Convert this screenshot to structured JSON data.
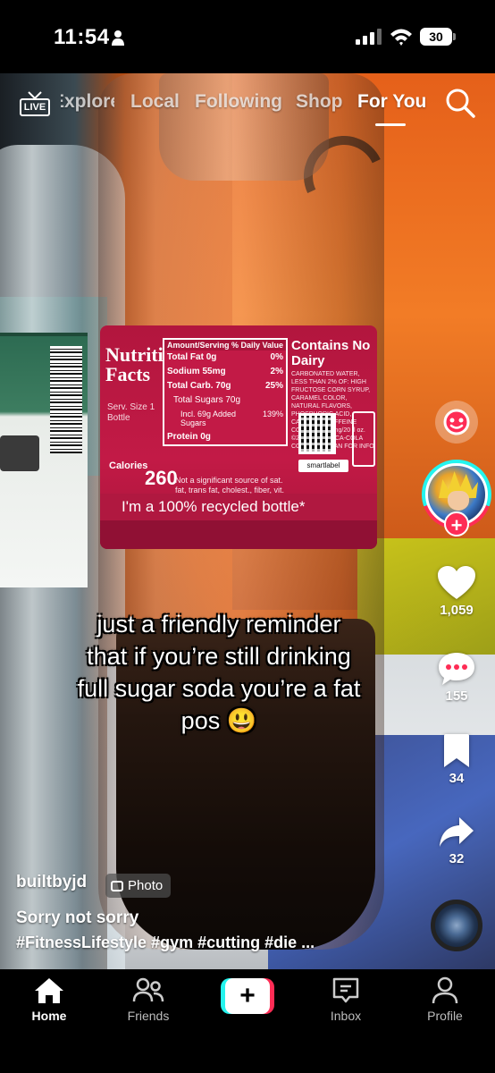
{
  "status_bar": {
    "time": "11:54",
    "battery": "30"
  },
  "top_nav": {
    "live_label": "LIVE",
    "tabs": [
      {
        "label": "Explore",
        "active": false
      },
      {
        "label": "Local",
        "active": false
      },
      {
        "label": "Following",
        "active": false
      },
      {
        "label": "Shop",
        "active": false
      },
      {
        "label": "For You",
        "active": true
      }
    ]
  },
  "media": {
    "label": {
      "nutrition_title": "Nutrition Facts",
      "serv_size": "Serv. Size 1 Bottle",
      "table_header_left": "Amount/Serving",
      "table_header_right": "% Daily Value",
      "rows": [
        {
          "name": "Total Fat 0g",
          "dv": "0%"
        },
        {
          "name": "Sodium 55mg",
          "dv": "2%"
        },
        {
          "name": "Total Carb. 70g",
          "dv": "25%"
        },
        {
          "name": "Total Sugars 70g",
          "dv": ""
        },
        {
          "name": "Incl. 69g Added Sugars",
          "dv": "139%"
        },
        {
          "name": "Protein 0g",
          "dv": ""
        }
      ],
      "calories_label": "Calories",
      "calories_value": "260",
      "note": "Not a significant source of sat. fat, trans fat, cholest., fiber, vit. D, calcium, iron and potas.",
      "contains_title": "Contains No Dairy",
      "contains_text": "CARBONATED WATER, LESS THAN 2% OF: HIGH FRUCTOSE CORN SYRUP, CARAMEL COLOR, NATURAL FLAVORS, PHOSPHORIC ACID, CAFFEINE. CAFFEINE CONTENT: 57 mg/20 fl oz. ©2026 THE COCA-COLA COMPANY. SCAN FOR INFO",
      "smartlabel": "smartlabel",
      "recycled_line": "I'm a 100% recycled bottle*"
    }
  },
  "caption": {
    "line1": "just a friendly reminder",
    "line2": "that if you’re still drinking",
    "line3": "full sugar soda you’re a fat",
    "line4": "pos 😃"
  },
  "rail": {
    "likes": "1,059",
    "comments": "155",
    "saves": "34",
    "shares": "32"
  },
  "post": {
    "username": "builtbyjd",
    "badge": "Photo",
    "description": "Sorry not sorry",
    "hashtags": "#FitnessLifestyle #gym #cutting #die ..."
  },
  "bottom_nav": {
    "items": [
      {
        "label": "Home",
        "active": true
      },
      {
        "label": "Friends",
        "active": false
      },
      {
        "label": "Inbox",
        "active": false
      },
      {
        "label": "Profile",
        "active": false
      }
    ]
  },
  "colors": {
    "tiktok_pink": "#fe2c55",
    "tiktok_cyan": "#25f4ee",
    "label_red": "#b2163e"
  }
}
